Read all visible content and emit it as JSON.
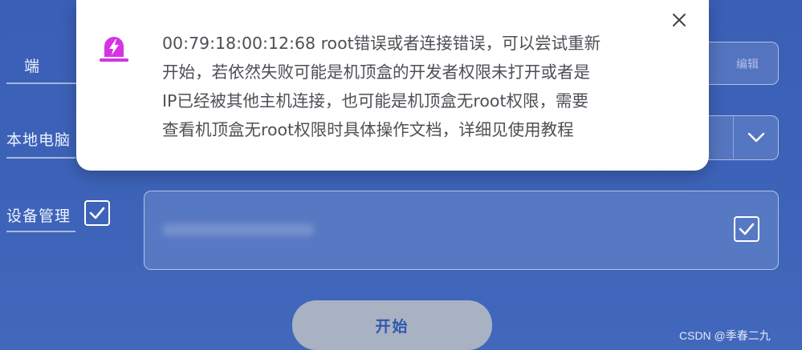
{
  "form": {
    "tab_label": "端",
    "edit_label": "编辑",
    "local_pc_label": "本地电脑",
    "device_mgmt_label": "设备管理",
    "device_mgmt_checked": true,
    "device_list_checked": true,
    "start_button_label": "开始"
  },
  "dialog": {
    "message_lines": [
      "00:79:18:00:12:68 root错误或者连接错误，可以尝试重新",
      "开始，若依然失败可能是机顶盒的开发者权限未打开或者是",
      "IP已经被其他主机连接，也可能是机顶盒无root权限，需要",
      "查看机顶盒无root权限时具体操作文档，详细见使用教程"
    ],
    "icon": "alarm-siren-icon",
    "icon_color": "#d633e6",
    "close_icon": "close-icon"
  },
  "watermark": "CSDN @季春二九",
  "colors": {
    "background": "#3d63b9",
    "start_button_bg": "#a9b2c2",
    "start_button_text": "#3057b0"
  }
}
